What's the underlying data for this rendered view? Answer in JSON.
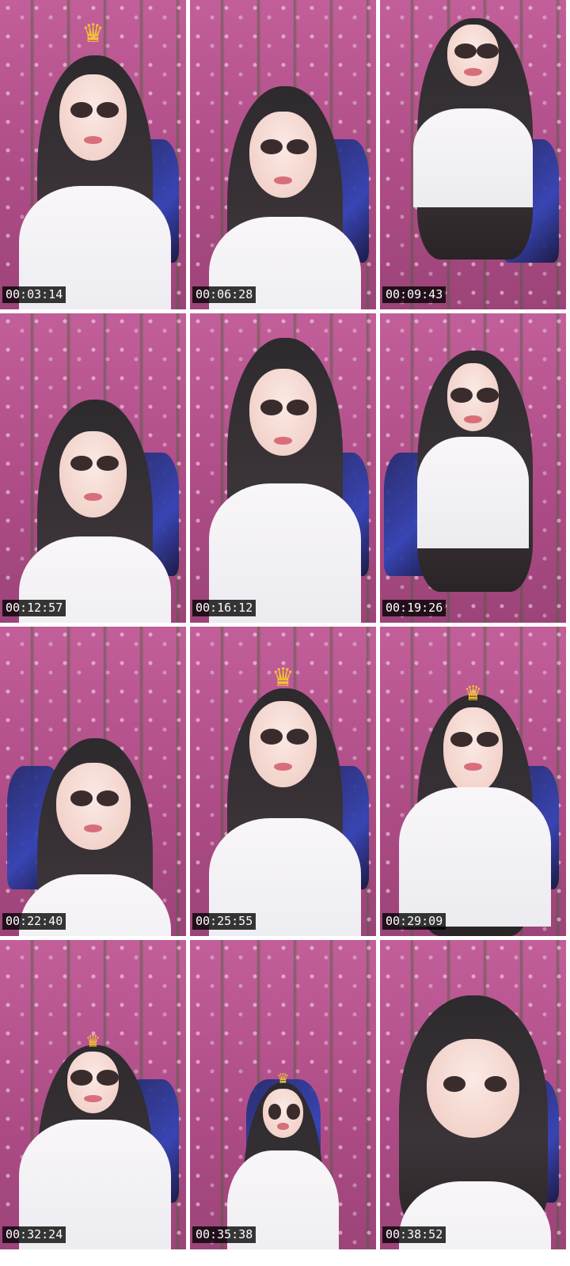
{
  "tiles": [
    {
      "timestamp": "00:03:14",
      "has_crown": true
    },
    {
      "timestamp": "00:06:28",
      "has_crown": false
    },
    {
      "timestamp": "00:09:43",
      "has_crown": false
    },
    {
      "timestamp": "00:12:57",
      "has_crown": false
    },
    {
      "timestamp": "00:16:12",
      "has_crown": false
    },
    {
      "timestamp": "00:19:26",
      "has_crown": false
    },
    {
      "timestamp": "00:22:40",
      "has_crown": false
    },
    {
      "timestamp": "00:25:55",
      "has_crown": true
    },
    {
      "timestamp": "00:29:09",
      "has_crown": true
    },
    {
      "timestamp": "00:32:24",
      "has_crown": true
    },
    {
      "timestamp": "00:35:38",
      "has_crown": true
    },
    {
      "timestamp": "00:38:52",
      "has_crown": false
    }
  ],
  "icons": {
    "crown": "crown-icon"
  },
  "colors": {
    "background_pink": "#b34d88",
    "timestamp_bg": "#000000",
    "timestamp_text": "#ffffff",
    "crown_gold": "#f1c232",
    "chair_blue": "#2c44b8"
  }
}
